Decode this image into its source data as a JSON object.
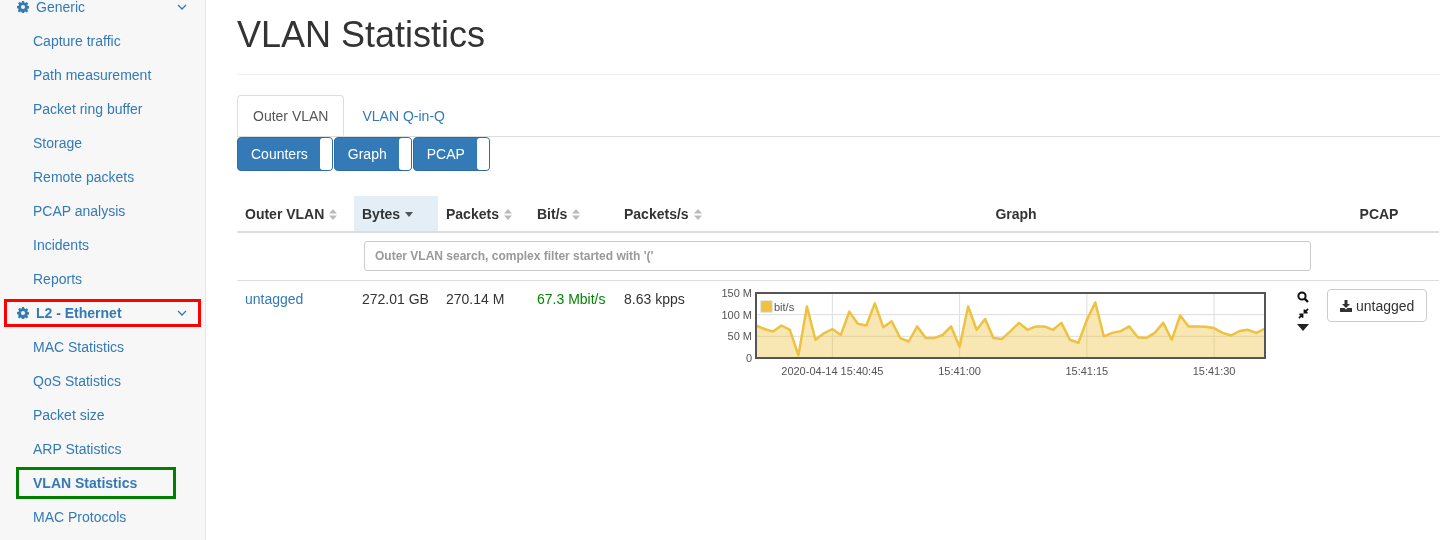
{
  "sidebar": {
    "groups": [
      {
        "label": "Generic",
        "expanded": true,
        "highlighted": false,
        "children": [
          {
            "label": "Capture traffic",
            "selected": false,
            "highlighted": false
          },
          {
            "label": "Path measurement",
            "selected": false,
            "highlighted": false
          },
          {
            "label": "Packet ring buffer",
            "selected": false,
            "highlighted": false
          },
          {
            "label": "Storage",
            "selected": false,
            "highlighted": false
          },
          {
            "label": "Remote packets",
            "selected": false,
            "highlighted": false
          },
          {
            "label": "PCAP analysis",
            "selected": false,
            "highlighted": false
          },
          {
            "label": "Incidents",
            "selected": false,
            "highlighted": false
          },
          {
            "label": "Reports",
            "selected": false,
            "highlighted": false
          }
        ]
      },
      {
        "label": "L2 - Ethernet",
        "expanded": true,
        "highlighted": true,
        "children": [
          {
            "label": "MAC Statistics",
            "selected": false,
            "highlighted": false
          },
          {
            "label": "QoS Statistics",
            "selected": false,
            "highlighted": false
          },
          {
            "label": "Packet size",
            "selected": false,
            "highlighted": false
          },
          {
            "label": "ARP Statistics",
            "selected": false,
            "highlighted": false
          },
          {
            "label": "VLAN Statistics",
            "selected": true,
            "highlighted": true
          },
          {
            "label": "MAC Protocols",
            "selected": false,
            "highlighted": false
          }
        ]
      }
    ]
  },
  "page_title": "VLAN Statistics",
  "tabs": [
    {
      "label": "Outer VLAN",
      "selected": true
    },
    {
      "label": "VLAN Q-in-Q",
      "selected": false
    }
  ],
  "toggle_buttons": [
    {
      "label": "Counters"
    },
    {
      "label": "Graph"
    },
    {
      "label": "PCAP"
    }
  ],
  "table": {
    "columns": [
      {
        "label": "Outer VLAN",
        "sortable": true,
        "sorted": false
      },
      {
        "label": "Bytes",
        "sortable": true,
        "sorted": true
      },
      {
        "label": "Packets",
        "sortable": true,
        "sorted": false
      },
      {
        "label": "Bit/s",
        "sortable": true,
        "sorted": false
      },
      {
        "label": "Packets/s",
        "sortable": true,
        "sorted": false
      },
      {
        "label": "Graph",
        "sortable": false,
        "sorted": false
      },
      {
        "label": "PCAP",
        "sortable": false,
        "sorted": false
      }
    ],
    "filter": {
      "placeholder": "Outer VLAN search, complex filter started with '('"
    },
    "rows": [
      {
        "vlan": "untagged",
        "bytes": "272.01 GB",
        "packets": "270.14 M",
        "bitrate": "67.3 Mbit/s",
        "pps": "8.63 kpps",
        "pcap_button": "untagged",
        "chart_data": {
          "type": "area",
          "grid": true,
          "categories": [
            null,
            null,
            null,
            null,
            null,
            null,
            null,
            null,
            null,
            "2020-04-14 15:40:45",
            null,
            null,
            null,
            null,
            null,
            null,
            null,
            null,
            null,
            null,
            null,
            null,
            null,
            null,
            "15:41:00",
            null,
            null,
            null,
            null,
            null,
            null,
            null,
            null,
            null,
            null,
            null,
            null,
            null,
            null,
            "15:41:15",
            null,
            null,
            null,
            null,
            null,
            null,
            null,
            null,
            null,
            null,
            null,
            null,
            null,
            null,
            "15:41:30",
            null,
            null,
            null,
            null,
            null,
            null
          ],
          "ylim": [
            0,
            150
          ],
          "yticks": [
            {
              "value": 0,
              "label": "0"
            },
            {
              "value": 50,
              "label": "50 M"
            },
            {
              "value": 100,
              "label": "100 M"
            },
            {
              "value": 150,
              "label": "150 M"
            }
          ],
          "series": [
            {
              "name": "bit/s",
              "color": "#edc240",
              "values": [
                75,
                67,
                61,
                75,
                65,
                6,
                119,
                42,
                57,
                67,
                53,
                107,
                79,
                75,
                126,
                71,
                85,
                46,
                38,
                73,
                46,
                46,
                53,
                73,
                26,
                119,
                65,
                90,
                46,
                44,
                62,
                81,
                65,
                73,
                73,
                65,
                81,
                42,
                35,
                88,
                128,
                50,
                58,
                62,
                73,
                48,
                46,
                58,
                81,
                42,
                98,
                73,
                73,
                72,
                69,
                58,
                52,
                62,
                65,
                58,
                68
              ]
            }
          ]
        }
      }
    ]
  }
}
